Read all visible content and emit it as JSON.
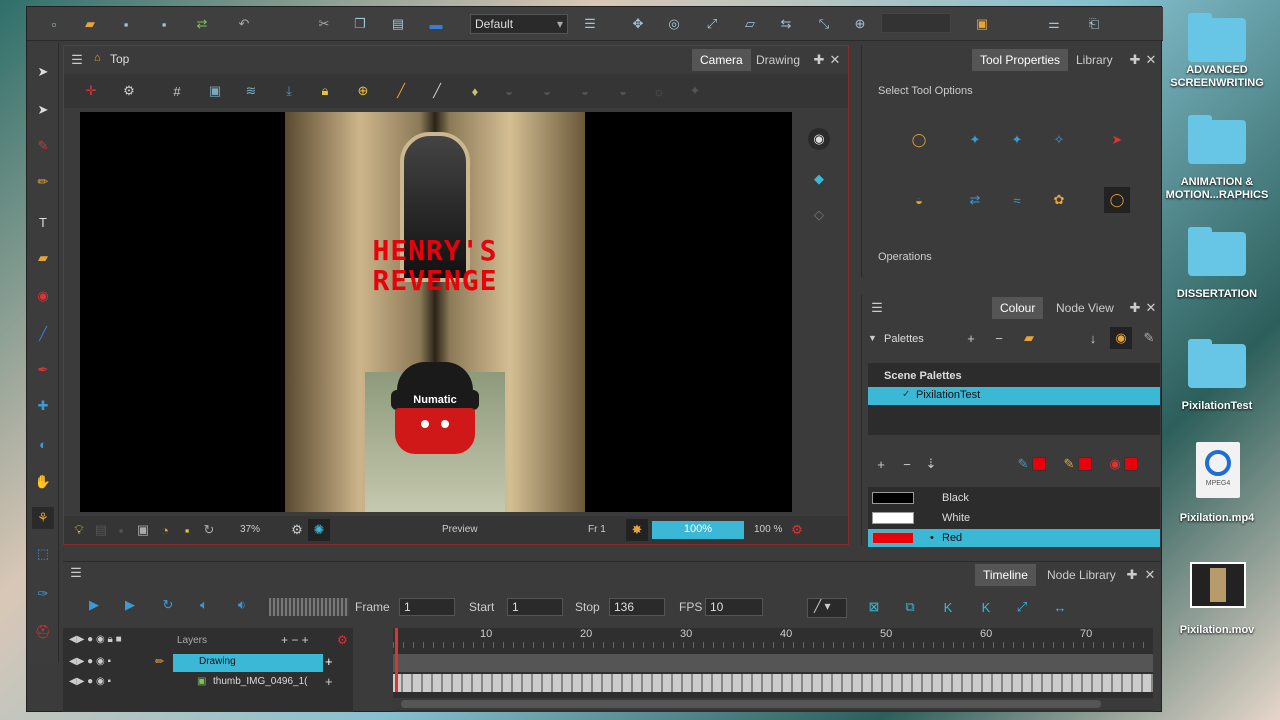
{
  "toolbar": {
    "workspace_select": "Default"
  },
  "camera_view": {
    "breadcrumb": "Top",
    "tabs": [
      "Camera",
      "Drawing"
    ],
    "zoom": "37%",
    "preview_label": "Preview",
    "frame_label": "Fr 1",
    "progress_label": "100%",
    "progress_value": 1.0,
    "zoom_percent": "100 %"
  },
  "artwork": {
    "title_line1": "HENRY'S",
    "title_line2": "REVENGE",
    "brand": "Numatic"
  },
  "tool_properties": {
    "tabs": [
      "Tool Properties",
      "Library"
    ],
    "select_options_label": "Select Tool Options",
    "operations_label": "Operations"
  },
  "colour_panel": {
    "tabs": [
      "Colour",
      "Node View"
    ],
    "palettes_label": "Palettes",
    "scene_palettes_label": "Scene Palettes",
    "palette_item": "PixilationTest",
    "colours": [
      {
        "name": "Black",
        "hex": "#000000"
      },
      {
        "name": "White",
        "hex": "#ffffff"
      },
      {
        "name": "Red",
        "hex": "#e8000b"
      }
    ]
  },
  "timeline": {
    "tabs": [
      "Timeline",
      "Node Library"
    ],
    "frame_label": "Frame",
    "frame_value": "1",
    "start_label": "Start",
    "start_value": "1",
    "stop_label": "Stop",
    "stop_value": "136",
    "fps_label": "FPS",
    "fps_value": "10",
    "layers_label": "Layers",
    "layers": [
      "Drawing",
      "thumb_IMG_0496_1("
    ],
    "ruler_ticks": [
      "10",
      "20",
      "30",
      "40",
      "50",
      "60",
      "70"
    ]
  },
  "desktop": {
    "items": [
      "ADVANCED SCREENWRITING",
      "ANIMATION & MOTION...RAPHICS",
      "DISSERTATION",
      "PixilationTest",
      "Pixilation.mp4",
      "Pixilation.mov"
    ],
    "mpeg_badge": "MPEG4"
  }
}
